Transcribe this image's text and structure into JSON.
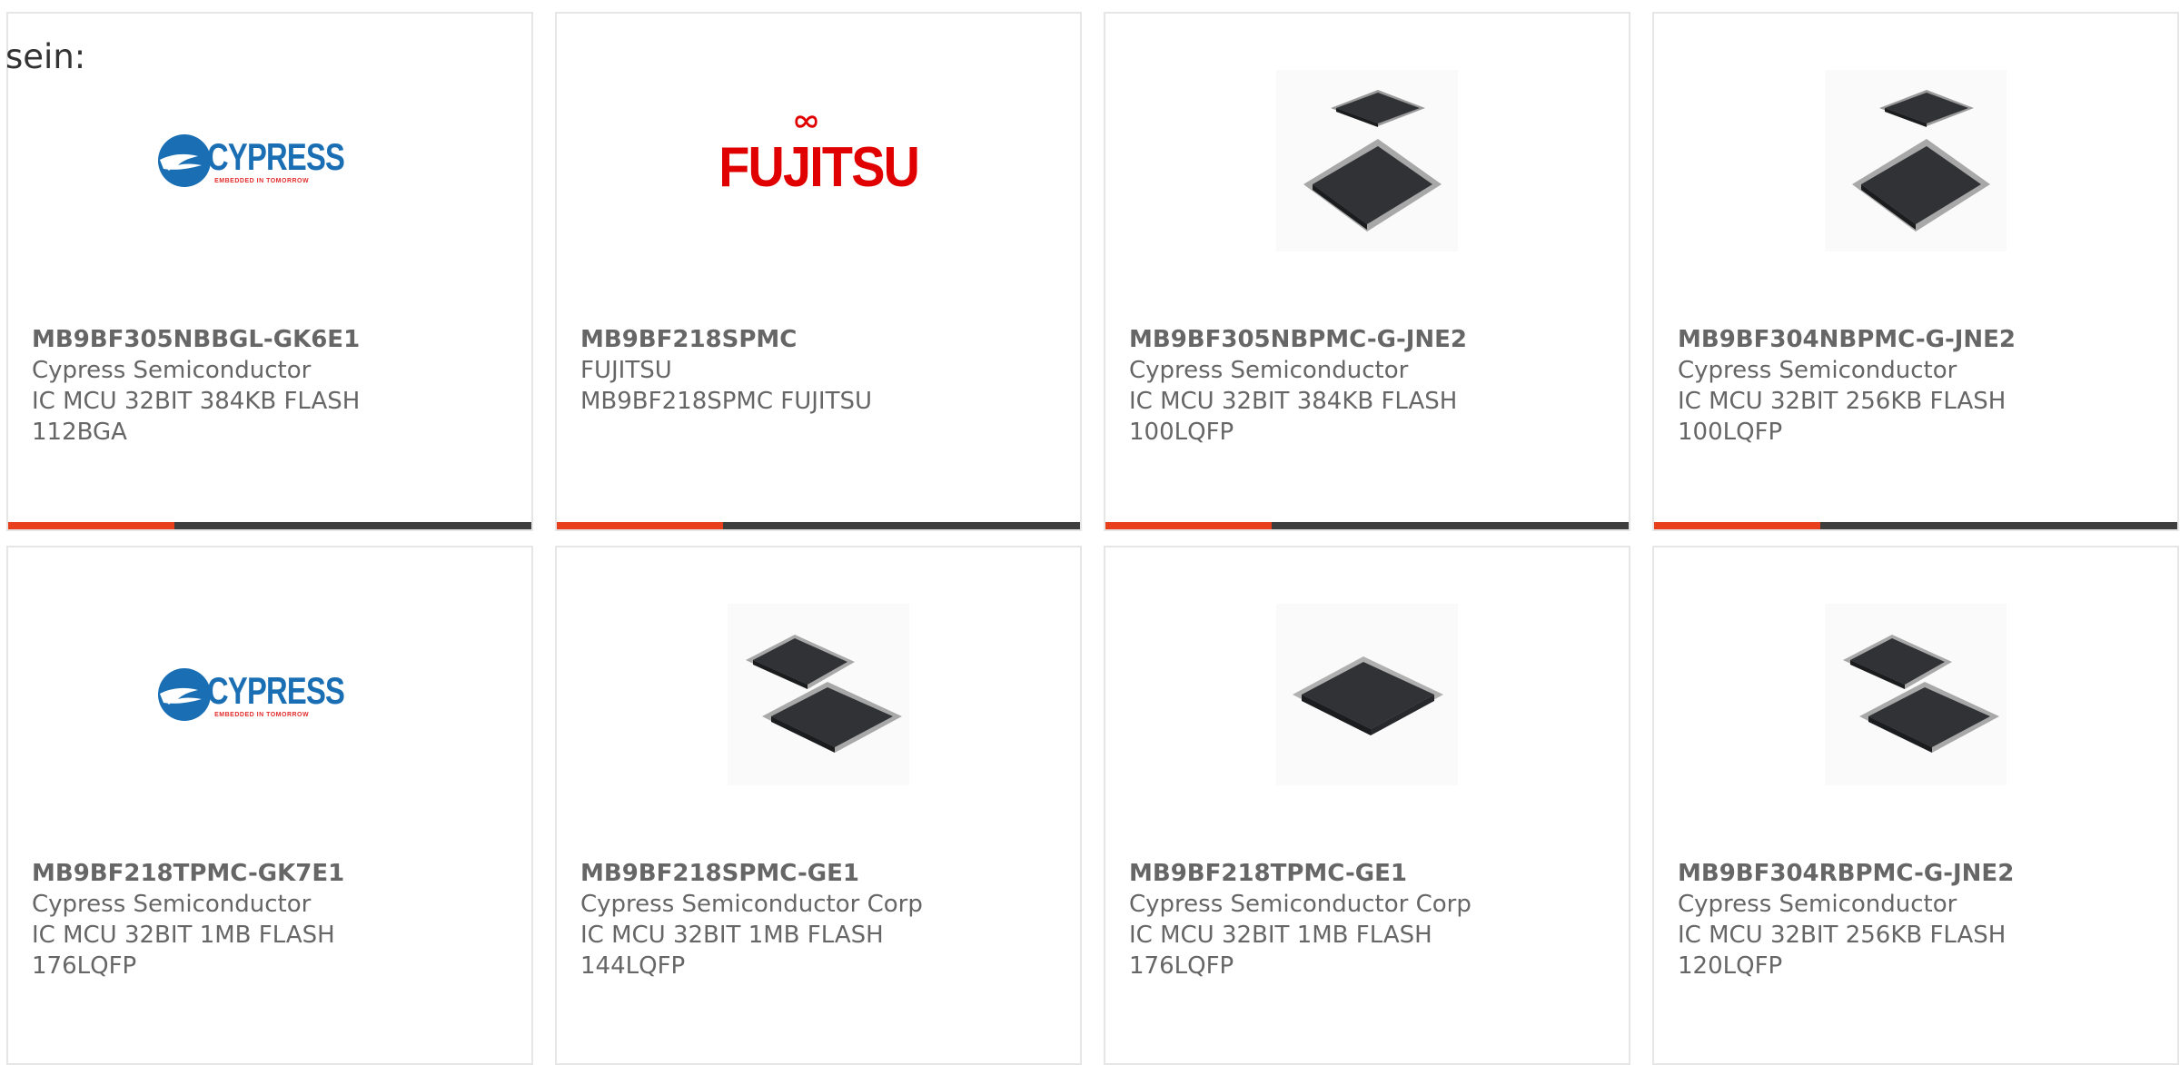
{
  "leading_text": "sein:",
  "colors": {
    "accent": "#e8401c",
    "bar_dark": "#3e3e3e",
    "cypress_blue": "#1a6fb4",
    "cypress_red": "#e32d2d",
    "fujitsu_red": "#e00000",
    "chip_dark": "#303235"
  },
  "products": [
    {
      "part_number": "MB9BF305NBBGL-GK6E1",
      "manufacturer": "Cypress Semiconductor",
      "description": "IC MCU 32BIT 384KB FLASH 112BGA",
      "image": "cypress-logo",
      "accent_fraction": 0.32
    },
    {
      "part_number": "MB9BF218SPMC",
      "manufacturer": "FUJITSU",
      "description": "MB9BF218SPMC FUJITSU",
      "image": "fujitsu-logo",
      "accent_fraction": 0.32
    },
    {
      "part_number": "MB9BF305NBPMC-G-JNE2",
      "manufacturer": "Cypress Semiconductor",
      "description": "IC MCU 32BIT 384KB FLASH 100LQFP",
      "image": "two-qfp-chips",
      "accent_fraction": 0.32
    },
    {
      "part_number": "MB9BF304NBPMC-G-JNE2",
      "manufacturer": "Cypress Semiconductor",
      "description": "IC MCU 32BIT 256KB FLASH 100LQFP",
      "image": "two-qfp-chips",
      "accent_fraction": 0.32
    },
    {
      "part_number": "MB9BF218TPMC-GK7E1",
      "manufacturer": "Cypress Semiconductor",
      "description": "IC MCU 32BIT 1MB FLASH 176LQFP",
      "image": "cypress-logo"
    },
    {
      "part_number": "MB9BF218SPMC-GE1",
      "manufacturer": "Cypress Semiconductor Corp",
      "description": "IC MCU 32BIT 1MB FLASH 144LQFP",
      "image": "two-qfp-chips-stacked"
    },
    {
      "part_number": "MB9BF218TPMC-GE1",
      "manufacturer": "Cypress Semiconductor Corp",
      "description": "IC MCU 32BIT 1MB FLASH 176LQFP",
      "image": "single-qfp-chip"
    },
    {
      "part_number": "MB9BF304RBPMC-G-JNE2",
      "manufacturer": "Cypress Semiconductor",
      "description": "IC MCU 32BIT 256KB FLASH 120LQFP",
      "image": "two-qfp-chips-stacked"
    }
  ],
  "cypress_logo": {
    "name": "CYPRESS",
    "tagline": "EMBEDDED IN TOMORROW"
  },
  "fujitsu_logo": {
    "name": "FUJITSU"
  }
}
